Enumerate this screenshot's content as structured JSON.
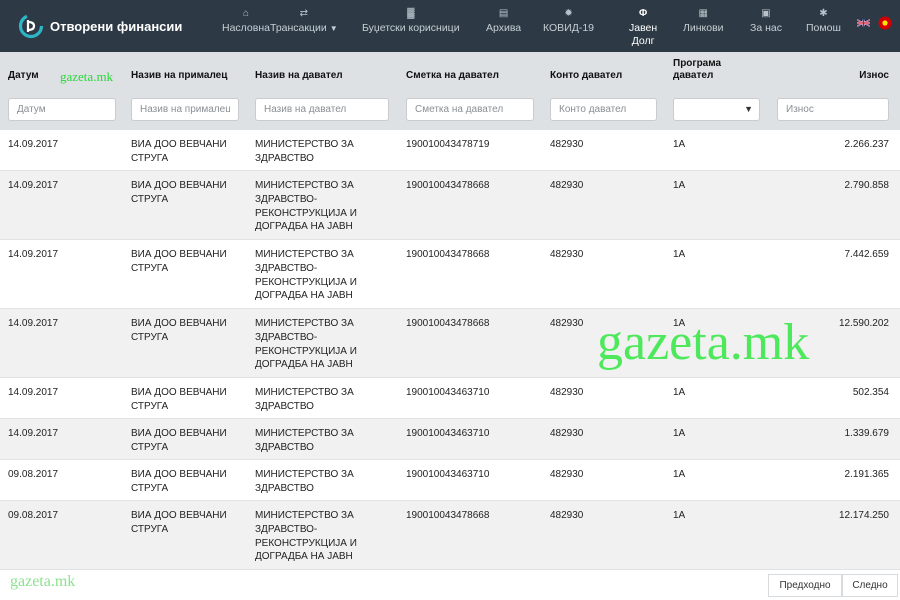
{
  "brand": {
    "name": "Отворени финансии"
  },
  "nav": [
    {
      "label": "Насловна",
      "icon": "home-icon",
      "glyph": "⌂"
    },
    {
      "label": "Трансакции",
      "icon": "exchange-icon",
      "glyph": "⇄"
    },
    {
      "label": "Буџетски корисници",
      "icon": "building-icon",
      "glyph": "▓"
    },
    {
      "label": "Архива",
      "icon": "document-icon",
      "glyph": "▤"
    },
    {
      "label": "КОВИД-19",
      "icon": "virus-icon",
      "glyph": "✹"
    },
    {
      "label": "Јавен",
      "label2": "Долг",
      "icon": "phi-icon",
      "glyph": "Φ"
    },
    {
      "label": "Линкови",
      "icon": "grid-icon",
      "glyph": "▦"
    },
    {
      "label": "За нас",
      "icon": "id-card-icon",
      "glyph": "▣"
    },
    {
      "label": "Помош",
      "icon": "asterisk-icon",
      "glyph": "✱"
    }
  ],
  "columns": [
    "Датум",
    "Назив на прималец",
    "Назив на давател",
    "Сметка на давател",
    "Конто давател",
    "Програма давател",
    "Износ"
  ],
  "filters": {
    "date": "Датум",
    "recipient": "Назив на прималец",
    "payer": "Назив на давател",
    "account": "Сметка на давател",
    "konto": "Конто давател",
    "amount": "Износ"
  },
  "rows": [
    {
      "date": "14.09.2017",
      "recipient": [
        "ВИА ДОО ВЕВЧАНИ",
        "СТРУГА"
      ],
      "payer": [
        "МИНИСТЕРСТВО ЗА",
        "ЗДРАВСТВО"
      ],
      "account": "190010043478719",
      "konto": "482930",
      "program": "1А",
      "amount": "2.266.237"
    },
    {
      "date": "14.09.2017",
      "recipient": [
        "ВИА ДОО ВЕВЧАНИ",
        "СТРУГА"
      ],
      "payer": [
        "МИНИСТЕРСТВО ЗА",
        "ЗДРАВСТВО-",
        "РЕКОНСТРУКЦИЈА И",
        "ДОГРАДБА НА ЈАВН"
      ],
      "account": "190010043478668",
      "konto": "482930",
      "program": "1А",
      "amount": "2.790.858"
    },
    {
      "date": "14.09.2017",
      "recipient": [
        "ВИА ДОО ВЕВЧАНИ",
        "СТРУГА"
      ],
      "payer": [
        "МИНИСТЕРСТВО ЗА",
        "ЗДРАВСТВО-",
        "РЕКОНСТРУКЦИЈА И",
        "ДОГРАДБА НА ЈАВН"
      ],
      "account": "190010043478668",
      "konto": "482930",
      "program": "1А",
      "amount": "7.442.659"
    },
    {
      "date": "14.09.2017",
      "recipient": [
        "ВИА ДОО ВЕВЧАНИ",
        "СТРУГА"
      ],
      "payer": [
        "МИНИСТЕРСТВО ЗА",
        "ЗДРАВСТВО-",
        "РЕКОНСТРУКЦИЈА И",
        "ДОГРАДБА НА ЈАВН"
      ],
      "account": "190010043478668",
      "konto": "482930",
      "program": "1А",
      "amount": "12.590.202"
    },
    {
      "date": "14.09.2017",
      "recipient": [
        "ВИА ДОО ВЕВЧАНИ",
        "СТРУГА"
      ],
      "payer": [
        "МИНИСТЕРСТВО ЗА",
        "ЗДРАВСТВО"
      ],
      "account": "190010043463710",
      "konto": "482930",
      "program": "1А",
      "amount": "502.354"
    },
    {
      "date": "14.09.2017",
      "recipient": [
        "ВИА ДОО ВЕВЧАНИ",
        "СТРУГА"
      ],
      "payer": [
        "МИНИСТЕРСТВО ЗА",
        "ЗДРАВСТВО"
      ],
      "account": "190010043463710",
      "konto": "482930",
      "program": "1А",
      "amount": "1.339.679"
    },
    {
      "date": "09.08.2017",
      "recipient": [
        "ВИА ДОО ВЕВЧАНИ",
        "СТРУГА"
      ],
      "payer": [
        "МИНИСТЕРСТВО ЗА",
        "ЗДРАВСТВО"
      ],
      "account": "190010043463710",
      "konto": "482930",
      "program": "1А",
      "amount": "2.191.365"
    },
    {
      "date": "09.08.2017",
      "recipient": [
        "ВИА ДОО ВЕВЧАНИ",
        "СТРУГА"
      ],
      "payer": [
        "МИНИСТЕРСТВО ЗА",
        "ЗДРАВСТВО-",
        "РЕКОНСТРУКЦИЈА И",
        "ДОГРАДБА НА ЈАВН"
      ],
      "account": "190010043478668",
      "konto": "482930",
      "program": "1А",
      "amount": "12.174.250"
    }
  ],
  "pagination": {
    "prev": "Предходно",
    "next": "Следно"
  },
  "watermark": {
    "text": "gazeta.mk"
  },
  "colors": {
    "navbar": "#2d3a45",
    "header": "#dde1e4",
    "watermark": "#3ce84b"
  }
}
